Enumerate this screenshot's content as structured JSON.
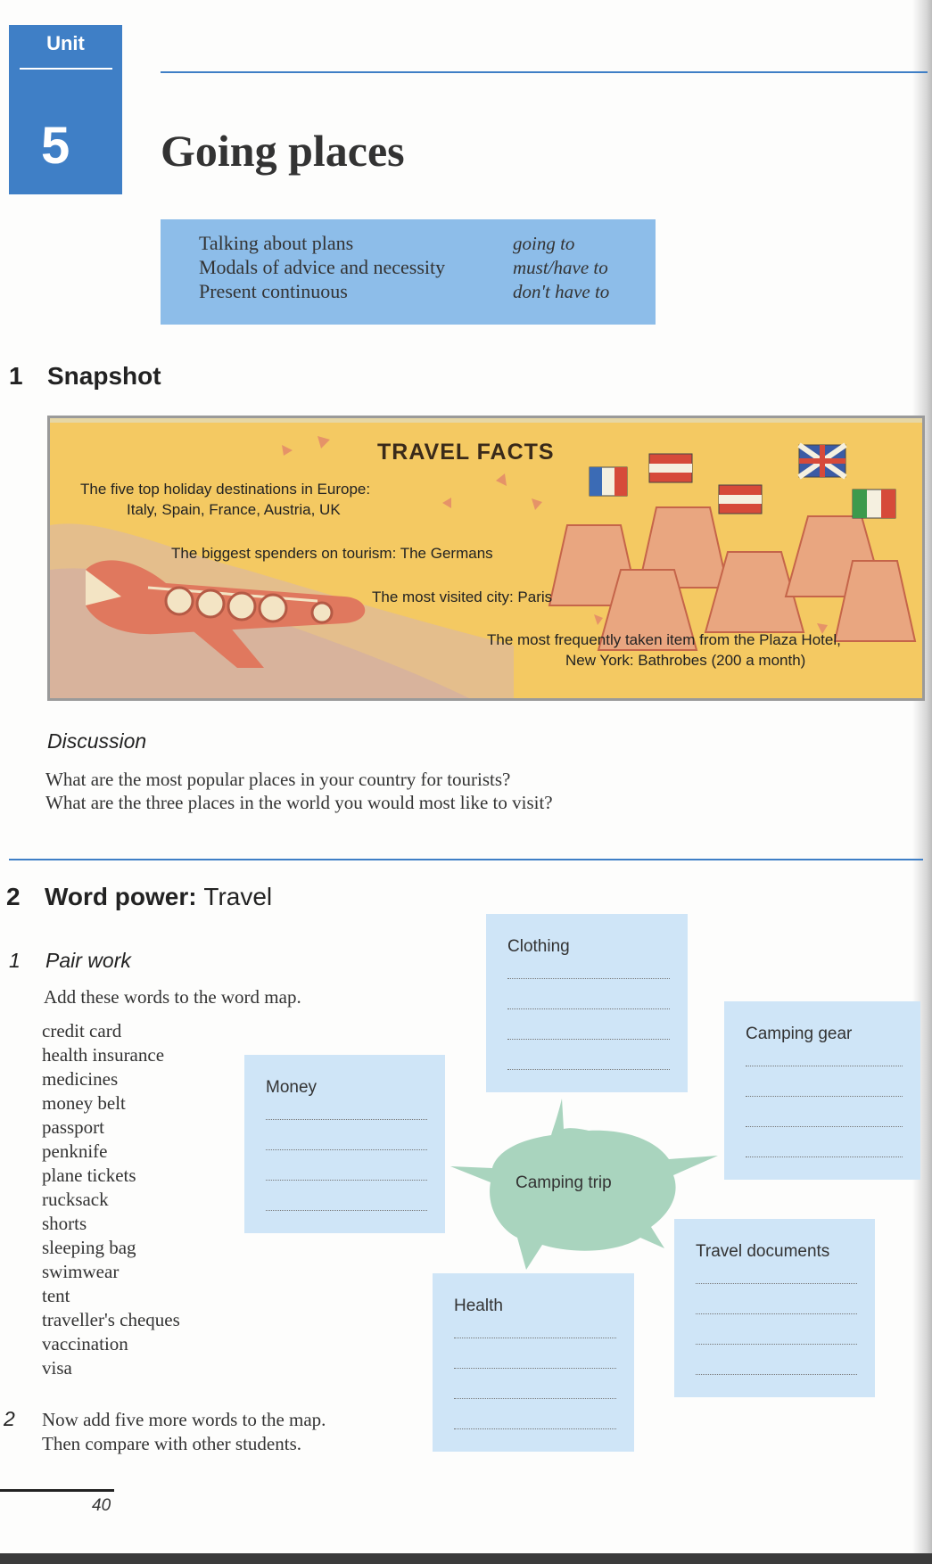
{
  "header": {
    "unit_label": "Unit",
    "unit_number": "5",
    "title": "Going places"
  },
  "topics": [
    {
      "topic": "Talking about plans",
      "grammar": "going to"
    },
    {
      "topic": "Modals of advice and necessity",
      "grammar": "must/have to"
    },
    {
      "topic": "Present continuous",
      "grammar": "don't have to"
    }
  ],
  "snapshot": {
    "number": "1",
    "heading": "Snapshot",
    "title": "TRAVEL FACTS",
    "facts": [
      "The five top holiday destinations in Europe:",
      "Italy, Spain, France, Austria, UK",
      "The biggest spenders on tourism: The Germans",
      "The most visited city: Paris",
      "The most frequently taken item from the Plaza Hotel,",
      "New York: Bathrobes (200 a month)"
    ]
  },
  "discussion": {
    "heading": "Discussion",
    "questions": [
      "What are the most popular places in your country for tourists?",
      "What are the three places in the world you would most like to visit?"
    ]
  },
  "word_power": {
    "number": "2",
    "heading": "Word power:",
    "subheading": "Travel",
    "task1": {
      "number": "1",
      "heading": "Pair work",
      "instruction": "Add these words to the word map."
    },
    "words": [
      "credit card",
      "health insurance",
      "medicines",
      "money belt",
      "passport",
      "penknife",
      "plane tickets",
      "rucksack",
      "shorts",
      "sleeping bag",
      "swimwear",
      "tent",
      "traveller's cheques",
      "vaccination",
      "visa"
    ],
    "task2": {
      "number": "2",
      "line1": "Now add five more words to the map.",
      "line2": "Then compare with other students."
    },
    "word_map": {
      "center": "Camping trip",
      "clothing": "Clothing",
      "camping_gear": "Camping gear",
      "money": "Money",
      "travel_documents": "Travel documents",
      "health": "Health"
    }
  },
  "footer": {
    "page_number": "40"
  },
  "colors": {
    "accent_blue": "#3f7fc6",
    "topics_box": "#8dbde9",
    "map_box": "#cfe5f7",
    "snapshot_bg": "#f4c962",
    "speech_bubble": "#a9d4be"
  }
}
